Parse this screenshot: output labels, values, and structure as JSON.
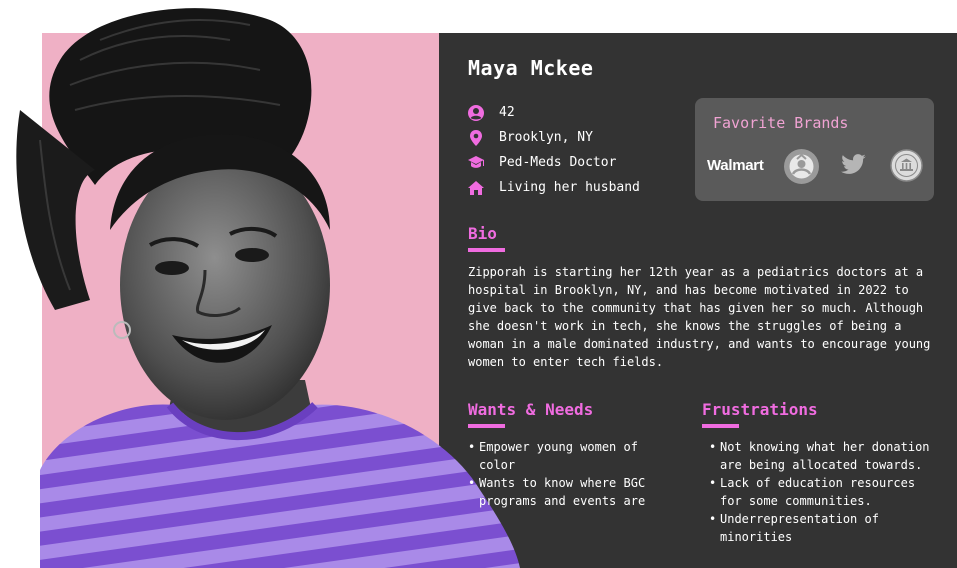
{
  "persona": {
    "name": "Maya Mckee",
    "facts": [
      {
        "icon": "person-icon",
        "text": "42"
      },
      {
        "icon": "location-pin-icon",
        "text": "Brooklyn, NY"
      },
      {
        "icon": "graduation-cap-icon",
        "text": "Ped-Meds Doctor"
      },
      {
        "icon": "home-icon",
        "text": "Living her husband"
      }
    ]
  },
  "brands": {
    "title": "Favorite Brands",
    "items": [
      {
        "name": "Walmart",
        "icon": "walmart-logo"
      },
      {
        "icon": "starbucks-logo"
      },
      {
        "icon": "twitter-bird-icon"
      },
      {
        "icon": "seal-logo"
      }
    ]
  },
  "bio": {
    "title": "Bio",
    "text": "Zipporah is starting her 12th year as a pediatrics doctors at a hospital in Brooklyn, NY, and has become motivated in 2022 to give back to the community that has given her so much. Although she doesn't work in tech, she knows the struggles of being a woman in a male dominated industry, and wants to encourage young women to enter tech fields."
  },
  "wants": {
    "title": "Wants & Needs",
    "items": [
      "Empower young women of color",
      "Wants to know where BGC programs and events are"
    ]
  },
  "frustrations": {
    "title": "Frustrations",
    "items": [
      "Not knowing what her donation are being allocated towards.",
      "Lack of education resources for some communities.",
      "Underrepresentation of minorities"
    ]
  },
  "colors": {
    "accent": "#f06ce0",
    "panel": "#333333",
    "pink_background": "#efb0c5",
    "card": "#5a5a5a",
    "shirt": "#8a5ad8"
  }
}
